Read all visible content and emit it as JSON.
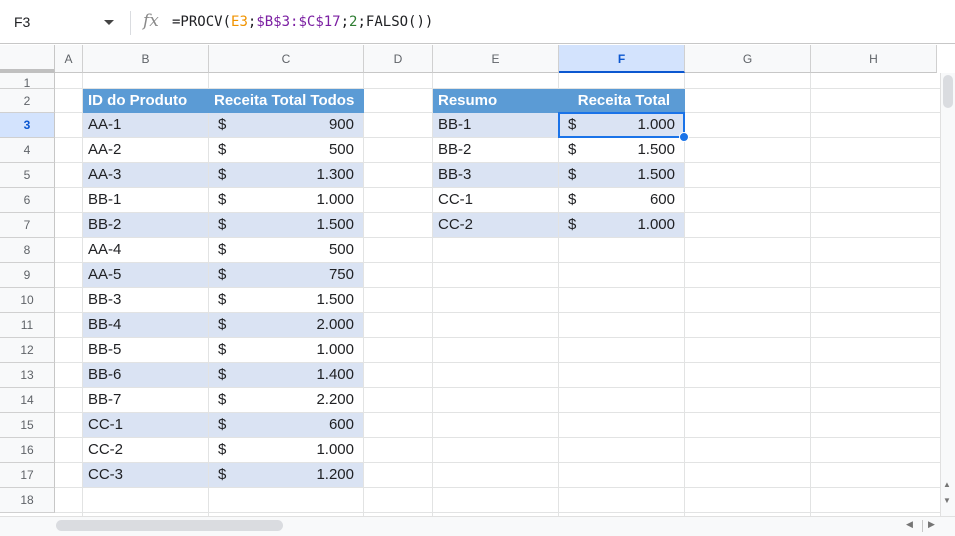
{
  "formula_bar": {
    "name_box": "F3",
    "fx_label": "fx",
    "formula_parts": [
      "=PROCV(",
      "E3",
      ";",
      "$B$3:$C$17",
      ";",
      "2",
      ";FALSO())"
    ]
  },
  "columns": [
    "A",
    "B",
    "C",
    "D",
    "E",
    "F",
    "G",
    "H"
  ],
  "selected_column": "F",
  "rows": [
    "1",
    "2",
    "3",
    "4",
    "5",
    "6",
    "7",
    "8",
    "9",
    "10",
    "11",
    "12",
    "13",
    "14",
    "15",
    "16",
    "17",
    "18"
  ],
  "selected_row": "3",
  "table1": {
    "headers": [
      "ID do Produto",
      "Receita Total Todos"
    ],
    "rows": [
      {
        "id": "AA-1",
        "currency": "$",
        "value": "900"
      },
      {
        "id": "AA-2",
        "currency": "$",
        "value": "500"
      },
      {
        "id": "AA-3",
        "currency": "$",
        "value": "1.300"
      },
      {
        "id": "BB-1",
        "currency": "$",
        "value": "1.000"
      },
      {
        "id": "BB-2",
        "currency": "$",
        "value": "1.500"
      },
      {
        "id": "AA-4",
        "currency": "$",
        "value": "500"
      },
      {
        "id": "AA-5",
        "currency": "$",
        "value": "750"
      },
      {
        "id": "BB-3",
        "currency": "$",
        "value": "1.500"
      },
      {
        "id": "BB-4",
        "currency": "$",
        "value": "2.000"
      },
      {
        "id": "BB-5",
        "currency": "$",
        "value": "1.000"
      },
      {
        "id": "BB-6",
        "currency": "$",
        "value": "1.400"
      },
      {
        "id": "BB-7",
        "currency": "$",
        "value": "2.200"
      },
      {
        "id": "CC-1",
        "currency": "$",
        "value": "600"
      },
      {
        "id": "CC-2",
        "currency": "$",
        "value": "1.000"
      },
      {
        "id": "CC-3",
        "currency": "$",
        "value": "1.200"
      }
    ]
  },
  "table2": {
    "headers": [
      "Resumo",
      "Receita Total"
    ],
    "rows": [
      {
        "id": "BB-1",
        "currency": "$",
        "value": "1.000"
      },
      {
        "id": "BB-2",
        "currency": "$",
        "value": "1.500"
      },
      {
        "id": "BB-3",
        "currency": "$",
        "value": "1.500"
      },
      {
        "id": "CC-1",
        "currency": "$",
        "value": "600"
      },
      {
        "id": "CC-2",
        "currency": "$",
        "value": "1.000"
      }
    ]
  },
  "colors": {
    "table_header": "#5b9bd5",
    "band": "#dae3f3",
    "selection": "#1a73e8"
  }
}
